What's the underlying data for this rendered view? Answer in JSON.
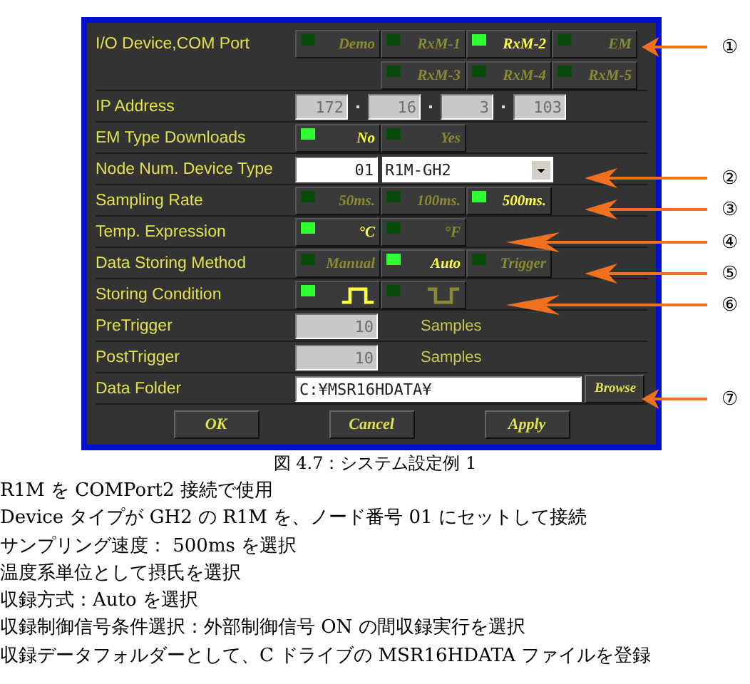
{
  "dialog": {
    "rows": [
      {
        "kind": "options",
        "label": "I/O Device,COM Port",
        "lines": [
          [
            {
              "label": "Demo",
              "selected": false
            },
            {
              "label": "RxM-1",
              "selected": false
            },
            {
              "label": "RxM-2",
              "selected": true
            },
            {
              "label": "EM",
              "selected": false
            }
          ],
          [
            {
              "label": "RxM-3",
              "selected": false
            },
            {
              "label": "RxM-4",
              "selected": false
            },
            {
              "label": "RxM-5",
              "selected": false
            }
          ]
        ]
      },
      {
        "kind": "ip",
        "label": "IP Address",
        "octets": [
          "172",
          "16",
          "3",
          "103"
        ]
      },
      {
        "kind": "options",
        "label": "EM Type Downloads",
        "lines": [
          [
            {
              "label": "No",
              "selected": true
            },
            {
              "label": "Yes",
              "selected": false
            }
          ]
        ]
      },
      {
        "kind": "node",
        "label": "Node Num. Device Type",
        "node": "01",
        "device": "R1M-GH2"
      },
      {
        "kind": "options",
        "label": "Sampling Rate",
        "lines": [
          [
            {
              "label": "50ms.",
              "selected": false
            },
            {
              "label": "100ms.",
              "selected": false
            },
            {
              "label": "500ms.",
              "selected": true
            }
          ]
        ]
      },
      {
        "kind": "options",
        "label": "Temp. Expression",
        "lines": [
          [
            {
              "label": "°C",
              "selected": true
            },
            {
              "label": "°F",
              "selected": false
            }
          ]
        ]
      },
      {
        "kind": "options",
        "label": "Data Storing Method",
        "lines": [
          [
            {
              "label": "Manual",
              "selected": false
            },
            {
              "label": "Auto",
              "selected": true
            },
            {
              "label": "Trigger",
              "selected": false
            }
          ]
        ]
      },
      {
        "kind": "options",
        "label": "Storing Condition",
        "lines": [
          [
            {
              "kind": "pulse-high",
              "selected": true
            },
            {
              "kind": "pulse-low",
              "selected": false
            }
          ]
        ]
      },
      {
        "kind": "count",
        "label": "PreTrigger",
        "value": "10",
        "unit": "Samples"
      },
      {
        "kind": "count",
        "label": "PostTrigger",
        "value": "10",
        "unit": "Samples"
      },
      {
        "kind": "folder",
        "label": "Data Folder",
        "value": "C:¥MSR16HDATA¥",
        "button": "Browse"
      }
    ],
    "buttons": [
      "OK",
      "Cancel",
      "Apply"
    ]
  },
  "callouts": [
    "①",
    "②",
    "③",
    "④",
    "⑤",
    "⑥",
    "⑦"
  ],
  "caption": "図 4.7：システム設定例 1",
  "notes": [
    "R1M を COMPort2 接続で使用",
    "Device タイプが GH2 の R1M を、ノード番号  01  にセットして接続",
    "サンプリング速度：  500ms  を選択",
    "温度系単位として摂氏を選択",
    "収録方式：Auto を選択",
    "収録制御信号条件選択：外部制御信号 ON の間収録実行を選択",
    "収録データフォルダーとして、C ドライブの MSR16HDATA ファイルを登録"
  ]
}
